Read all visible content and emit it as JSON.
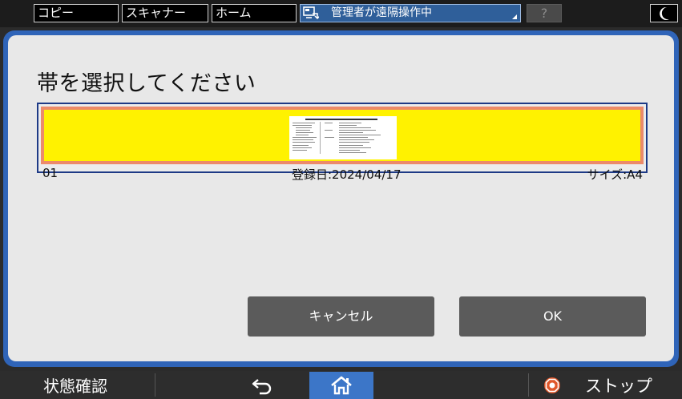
{
  "topbar": {
    "tabs": [
      {
        "label": "コピー"
      },
      {
        "label": "スキャナー"
      },
      {
        "label": "ホーム"
      }
    ],
    "remote_status": "管理者が遠隔操作中",
    "help_label": "?",
    "night_icon": "moon-icon"
  },
  "dialog": {
    "title": "帯を選択してください",
    "items": [
      {
        "number": "01",
        "date": "登録日:2024/04/17",
        "size": "サイズ:A4",
        "band_color": "#fff200",
        "band_border_color": "#ec8a6a"
      }
    ],
    "cancel_label": "キャンセル",
    "ok_label": "OK"
  },
  "bottombar": {
    "status_label": "状態確認",
    "back_icon": "back-arrow-icon",
    "home_icon": "home-icon",
    "stop_label": "ストップ",
    "stop_icon": "stop-icon"
  },
  "colors": {
    "dialog_border": "#2f64b8",
    "home_button": "#3c76c8",
    "stop_icon": "#e0572a",
    "button_bg": "#5b5b5b"
  }
}
